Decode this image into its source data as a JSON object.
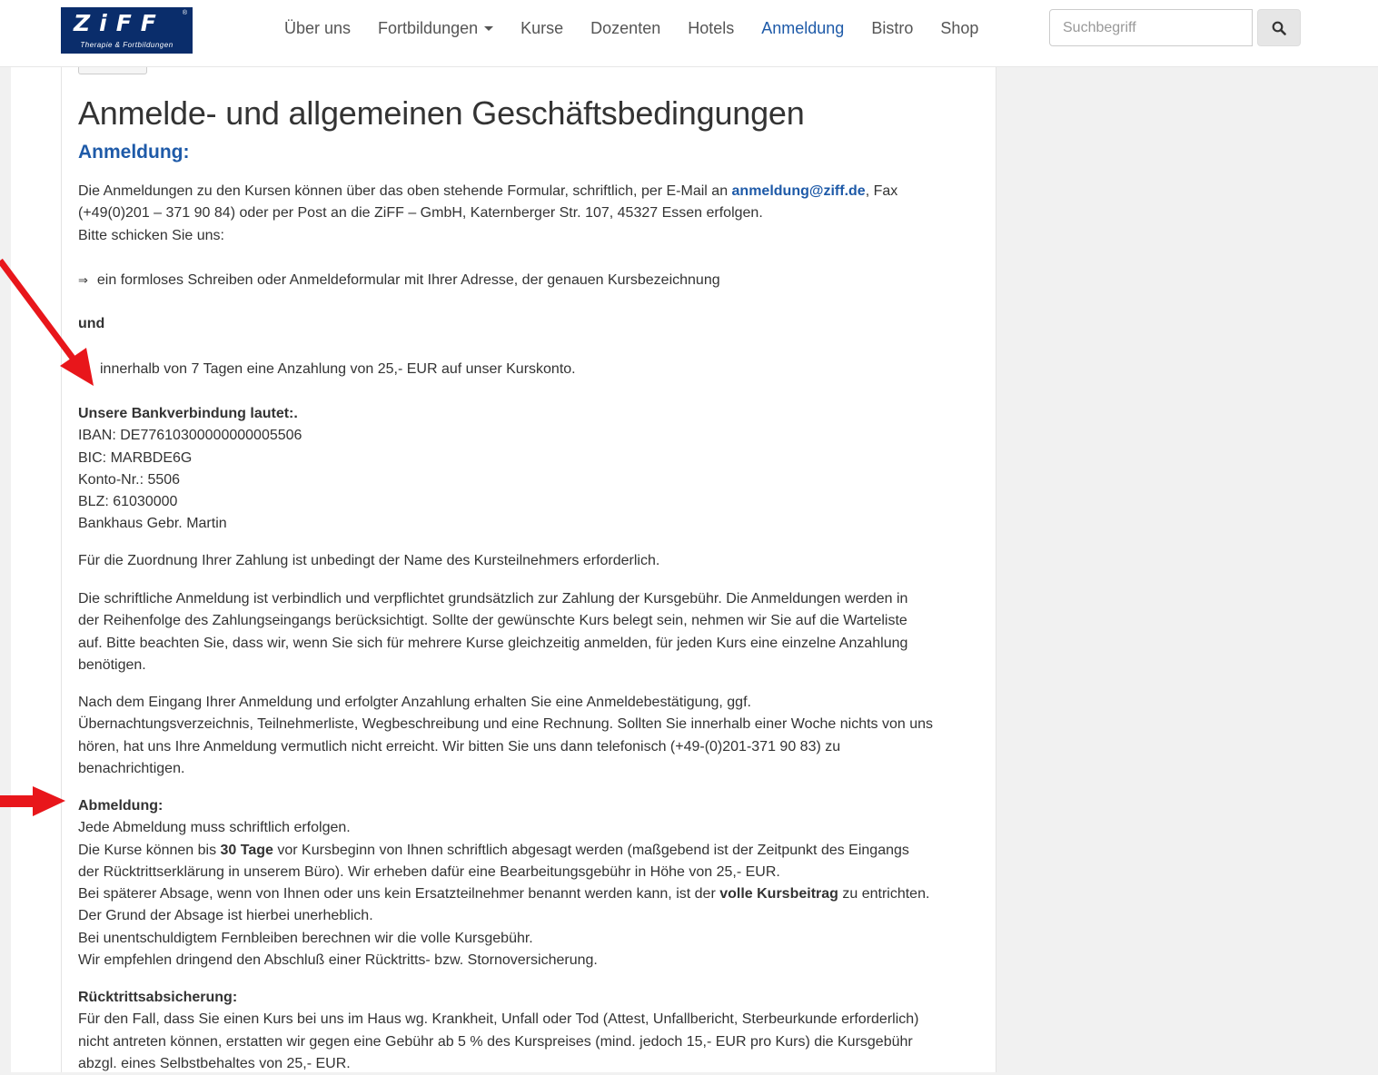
{
  "logo": {
    "main": "ZiFF",
    "sub": "Therapie & Fortbildungen",
    "registered": "®"
  },
  "nav": {
    "items": [
      "Über uns",
      "Fortbildungen",
      "Kurse",
      "Dozenten",
      "Hotels",
      "Anmeldung",
      "Bistro",
      "Shop"
    ],
    "active": "Anmeldung",
    "dropdown_item": "Fortbildungen"
  },
  "search": {
    "placeholder": "Suchbegriff",
    "icon": "search-icon"
  },
  "page": {
    "title": "Anmelde- und allgemeinen Geschäftsbedingungen",
    "section": "Anmeldung:",
    "intro_1a": "Die Anmeldungen zu den Kursen können über das oben stehende Formular, schriftlich, per E-Mail an ",
    "email": "anmeldung@ziff.de",
    "intro_1b": ", Fax",
    "intro_2": "(+49(0)201 – 371 90 84) oder per Post an die ZiFF – GmbH, Katernberger Str. 107, 45327 Essen erfolgen.",
    "intro_3": "Bitte schicken Sie uns:",
    "bullet_1": "ein formloses Schreiben oder Anmeldeformular mit Ihrer Adresse, der genauen Kursbezeichnung",
    "bullet_arrow": "⇒",
    "und": "und",
    "bullet_2": "innerhalb von 7 Tagen eine Anzahlung von 25,- EUR auf unser Kurskonto.",
    "bank_heading": "Unsere Bankverbindung lautet:.",
    "bank_lines": [
      "IBAN: DE77610300000000005506",
      "BIC: MARBDE6G",
      "Konto-Nr.: 5506",
      "BLZ: 61030000",
      "Bankhaus Gebr. Martin"
    ],
    "zuordnung": "Für die Zuordnung Ihrer Zahlung ist unbedingt der Name des Kursteilnehmers erforderlich.",
    "para_binding": [
      "Die schriftliche Anmeldung ist verbindlich und verpflichtet grundsätzlich zur Zahlung der Kursgebühr. Die Anmeldungen werden in",
      "der Reihenfolge des Zahlungseingangs berücksichtigt. Sollte der gewünschte Kurs belegt sein, nehmen wir Sie auf die Warteliste",
      "auf. Bitte beachten Sie, dass wir, wenn Sie sich für mehrere Kurse gleichzeitig anmelden, für jeden Kurs eine einzelne Anzahlung",
      "benötigen."
    ],
    "para_confirm": [
      "Nach dem Eingang Ihrer Anmeldung und erfolgter Anzahlung erhalten Sie eine Anmeldebestätigung, ggf.",
      "Übernachtungsverzeichnis, Teilnehmerliste, Wegbeschreibung und eine Rechnung. Sollten Sie innerhalb einer Woche nichts von uns",
      "hören, hat uns Ihre Anmeldung vermutlich nicht erreicht. Wir bitten Sie uns dann telefonisch (+49-(0)201-371 90 83) zu",
      "benachrichtigen."
    ],
    "abmeldung_heading": "Abmeldung:",
    "abm_1": "Jede Abmeldung muss schriftlich erfolgen.",
    "abm_2a": "Die Kurse können bis ",
    "abm_2b": "30 Tage",
    "abm_2c": " vor Kursbeginn von Ihnen schriftlich abgesagt werden (maßgebend ist der Zeitpunkt des Eingangs",
    "abm_3": "der Rücktrittserklärung in unserem Büro). Wir erheben dafür eine Bearbeitungsgebühr in Höhe von 25,- EUR.",
    "abm_4a": "Bei späterer Absage, wenn von Ihnen oder uns kein Ersatzteilnehmer benannt werden kann, ist der ",
    "abm_4b": "volle Kursbeitrag",
    "abm_4c": " zu entrichten.",
    "abm_5": "Der Grund der Absage ist hierbei unerheblich.",
    "abm_6": "Bei unentschuldigtem Fernbleiben berechnen wir die volle Kursgebühr.",
    "abm_7": "Wir empfehlen dringend den Abschluß einer Rücktritts- bzw. Stornoversicherung.",
    "ruecktritt_heading": "Rücktrittsabsicherung:",
    "ruecktritt_lines": [
      "Für den Fall, dass Sie einen Kurs bei uns im Haus wg. Krankheit, Unfall oder Tod (Attest, Unfallbericht, Sterbeurkunde erforderlich)",
      "nicht antreten können, erstatten wir gegen eine Gebühr ab 5 % des Kurspreises (mind. jedoch 15,- EUR pro Kurs) die Kursgebühr",
      "abzgl. eines Selbstbehaltes von 25,- EUR."
    ]
  },
  "colors": {
    "accent": "#1e5aa8",
    "logo_bg": "#0a2d6b",
    "annotation_arrow": "#e8161b"
  }
}
